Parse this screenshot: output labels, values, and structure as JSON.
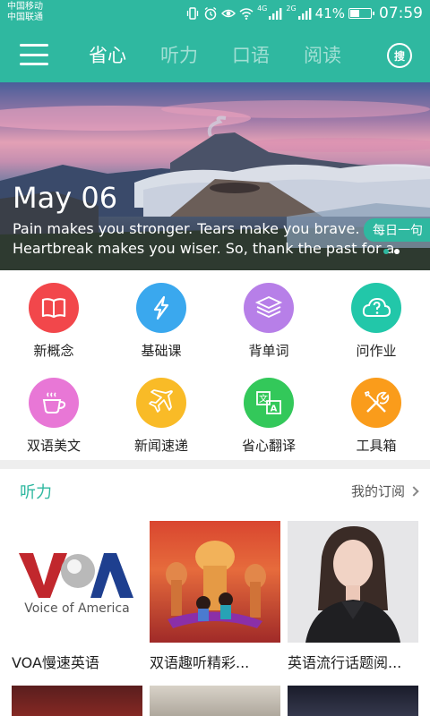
{
  "status_bar": {
    "carrier_1": "中国移动",
    "carrier_2": "中国联通",
    "network_1": "4G",
    "network_2": "2G",
    "battery_percent": "41%",
    "battery_level": 0.41,
    "time": "07:59",
    "icons": [
      "vibrate-icon",
      "alarm-icon",
      "eye-comfort-icon",
      "wifi-icon",
      "signal-icon",
      "signal-icon",
      "battery-icon"
    ]
  },
  "header": {
    "tabs": [
      {
        "label": "省心",
        "active": true
      },
      {
        "label": "听力",
        "active": false
      },
      {
        "label": "口语",
        "active": false
      },
      {
        "label": "阅读",
        "active": false
      }
    ],
    "search_label": "搜",
    "colors": {
      "primary": "#2fb8a0"
    }
  },
  "banner": {
    "date": "May 06",
    "quote_line_1": "Pain makes you stronger. Tears make you brave.",
    "quote_line_2": "Heartbreak makes you wiser. So, thank the past for a",
    "daily_tag": "每日一句",
    "page_count": 2,
    "active_page": 1
  },
  "features": [
    {
      "label": "新概念",
      "icon": "book-icon",
      "color": "#f2474b"
    },
    {
      "label": "基础课",
      "icon": "lightning-icon",
      "color": "#3aa8ee"
    },
    {
      "label": "背单词",
      "icon": "word-stack-icon",
      "color": "#b77fe8"
    },
    {
      "label": "问作业",
      "icon": "cloud-question-icon",
      "color": "#22c7a9"
    },
    {
      "label": "双语美文",
      "icon": "coffee-cup-icon",
      "color": "#e877d6"
    },
    {
      "label": "新闻速递",
      "icon": "airplane-icon",
      "color": "#f9bb27"
    },
    {
      "label": "省心翻译",
      "icon": "translate-icon",
      "color": "#33c85a"
    },
    {
      "label": "工具箱",
      "icon": "tools-icon",
      "color": "#fa9c1b"
    }
  ],
  "listening": {
    "title": "听力",
    "more_label": "我的订阅",
    "cards": [
      {
        "caption": "VOA慢速英语",
        "logo_text": "Voice of America"
      },
      {
        "caption": "双语趣听精彩..."
      },
      {
        "caption": "英语流行话题阅..."
      }
    ]
  }
}
